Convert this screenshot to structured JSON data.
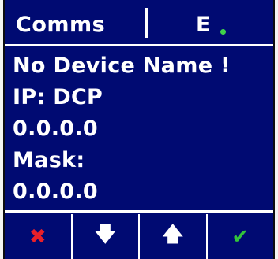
{
  "header": {
    "left_title": "Comms",
    "right_title": "E"
  },
  "status_dot_color": "#3fd24a",
  "content": {
    "line1": "No Device Name !",
    "line2": "IP: DCP",
    "line3": "0.0.0.0",
    "line4": "Mask:",
    "line5": "0.0.0.0"
  },
  "footer": {
    "cancel_glyph": "✖",
    "down_glyph": "🡇",
    "up_glyph": "🡅",
    "ok_glyph": "✔",
    "cancel_color": "#e8202a",
    "ok_color": "#33c43a"
  }
}
